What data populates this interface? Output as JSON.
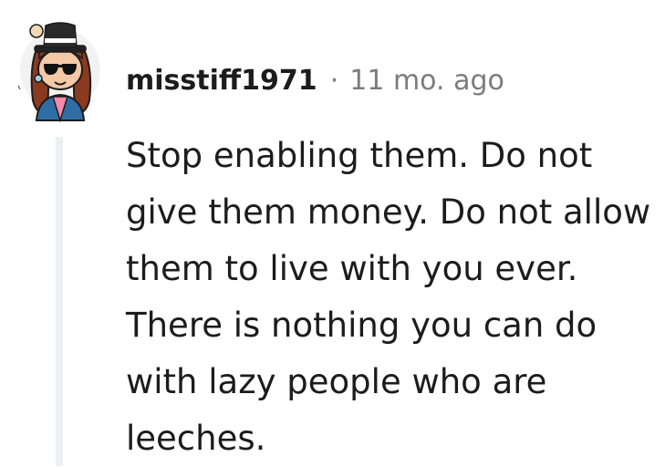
{
  "comment": {
    "username": "misstiff1971",
    "separator": "·",
    "timestamp": "11 mo. ago",
    "body": "Stop enabling them. Do not give them money. Do not allow them to live with you ever. There is nothing you can do with lazy people who are leeches."
  },
  "icons": {
    "avatar": "snoo-avatar-icon"
  },
  "colors": {
    "username": "#1c1c1c",
    "meta": "#7c7c7c",
    "thread_line": "#edeff1",
    "body_text": "#1c1c1c"
  }
}
